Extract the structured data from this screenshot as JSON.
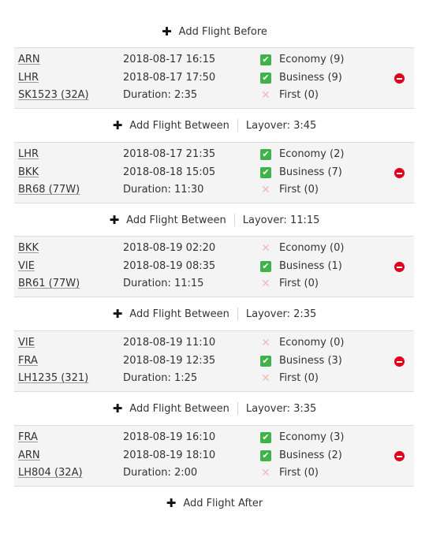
{
  "add_before": "Add Flight Before",
  "add_after": "Add Flight After",
  "add_between": "Add Flight Between",
  "flights": [
    {
      "origin": "ARN",
      "destination": "LHR",
      "flight": "SK1523 (32A)",
      "departure": "2018-08-17 16:15",
      "arrival": "2018-08-17 17:50",
      "duration": "Duration: 2:35",
      "classes": [
        {
          "label": "Economy (9)",
          "available": true
        },
        {
          "label": "Business (9)",
          "available": true
        },
        {
          "label": "First (0)",
          "available": false
        }
      ]
    },
    {
      "origin": "LHR",
      "destination": "BKK",
      "flight": "BR68 (77W)",
      "departure": "2018-08-17 21:35",
      "arrival": "2018-08-18 15:05",
      "duration": "Duration: 11:30",
      "classes": [
        {
          "label": "Economy (2)",
          "available": true
        },
        {
          "label": "Business (7)",
          "available": true
        },
        {
          "label": "First (0)",
          "available": false
        }
      ]
    },
    {
      "origin": "BKK",
      "destination": "VIE",
      "flight": "BR61 (77W)",
      "departure": "2018-08-19 02:20",
      "arrival": "2018-08-19 08:35",
      "duration": "Duration: 11:15",
      "classes": [
        {
          "label": "Economy (0)",
          "available": false
        },
        {
          "label": "Business (1)",
          "available": true
        },
        {
          "label": "First (0)",
          "available": false
        }
      ]
    },
    {
      "origin": "VIE",
      "destination": "FRA",
      "flight": "LH1235 (321)",
      "departure": "2018-08-19 11:10",
      "arrival": "2018-08-19 12:35",
      "duration": "Duration: 1:25",
      "classes": [
        {
          "label": "Economy (0)",
          "available": false
        },
        {
          "label": "Business (3)",
          "available": true
        },
        {
          "label": "First (0)",
          "available": false
        }
      ]
    },
    {
      "origin": "FRA",
      "destination": "ARN",
      "flight": "LH804 (32A)",
      "departure": "2018-08-19 16:10",
      "arrival": "2018-08-19 18:10",
      "duration": "Duration: 2:00",
      "classes": [
        {
          "label": "Economy (3)",
          "available": true
        },
        {
          "label": "Business (2)",
          "available": true
        },
        {
          "label": "First (0)",
          "available": false
        }
      ]
    }
  ],
  "layovers": [
    "Layover: 3:45",
    "Layover: 11:15",
    "Layover: 2:35",
    "Layover: 3:35"
  ]
}
